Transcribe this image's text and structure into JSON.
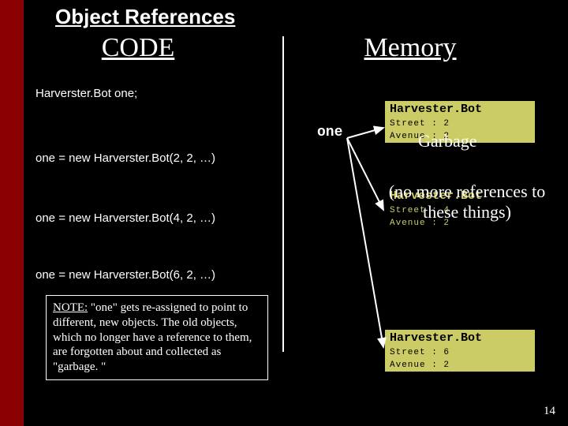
{
  "title": "Object References",
  "columns": {
    "code": "CODE",
    "memory": "Memory"
  },
  "code": {
    "line1": "Harverster.Bot one;",
    "line2": "one = new Harverster.Bot(2, 2, …)",
    "line3": "one = new Harverster.Bot(4, 2, …)",
    "line4": "one = new Harverster.Bot(6, 2, …)"
  },
  "pointer_label": "one",
  "garbage_label": "Garbage",
  "overlay": "(no more references to these things)",
  "boxes": {
    "box1": {
      "header": "Harvester.Bot",
      "rows": [
        "Street : 2",
        "Avenue : 2"
      ]
    },
    "box2": {
      "header": "Harvester.Bot",
      "rows": [
        "Street : 4",
        "Avenue : 2"
      ]
    },
    "box3": {
      "header": "Harvester.Bot",
      "rows": [
        "Street : 6",
        "Avenue : 2"
      ]
    }
  },
  "note": {
    "lead": "NOTE:",
    "body": " \"one\" gets re-assigned to point to different, new objects.  The old objects, which no longer have a reference to them, are forgotten about and collected as \"garbage. \""
  },
  "slide_number": "14"
}
